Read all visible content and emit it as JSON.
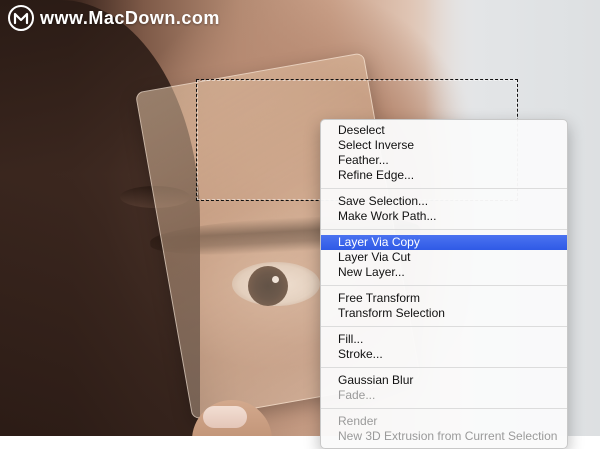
{
  "watermark": {
    "text": "www.MacDown.com"
  },
  "context_menu": {
    "groups": [
      {
        "items": [
          {
            "label": "Deselect",
            "enabled": true
          },
          {
            "label": "Select Inverse",
            "enabled": true
          },
          {
            "label": "Feather...",
            "enabled": true
          },
          {
            "label": "Refine Edge...",
            "enabled": true
          }
        ]
      },
      {
        "items": [
          {
            "label": "Save Selection...",
            "enabled": true
          },
          {
            "label": "Make Work Path...",
            "enabled": true
          }
        ]
      },
      {
        "items": [
          {
            "label": "Layer Via Copy",
            "enabled": true,
            "highlighted": true
          },
          {
            "label": "Layer Via Cut",
            "enabled": true
          },
          {
            "label": "New Layer...",
            "enabled": true
          }
        ]
      },
      {
        "items": [
          {
            "label": "Free Transform",
            "enabled": true
          },
          {
            "label": "Transform Selection",
            "enabled": true
          }
        ]
      },
      {
        "items": [
          {
            "label": "Fill...",
            "enabled": true
          },
          {
            "label": "Stroke...",
            "enabled": true
          }
        ]
      },
      {
        "items": [
          {
            "label": "Gaussian Blur",
            "enabled": true
          },
          {
            "label": "Fade...",
            "enabled": false
          }
        ]
      },
      {
        "items": [
          {
            "label": "Render",
            "enabled": false
          },
          {
            "label": "New 3D Extrusion from Current Selection",
            "enabled": false
          }
        ]
      }
    ]
  },
  "colors": {
    "highlight": "#2f5ae6",
    "disabled_text": "#9a9a9a"
  }
}
